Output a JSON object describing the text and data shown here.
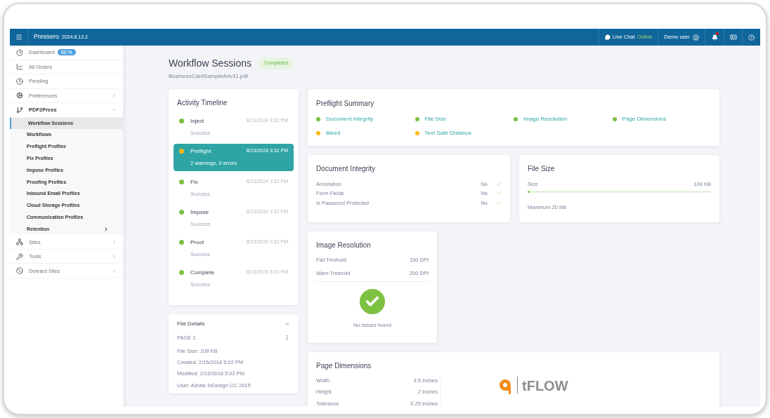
{
  "header": {
    "brand": "Pressero",
    "version": "2024.8.13.2",
    "live_chat": {
      "label": "Live Chat",
      "status": "Online"
    },
    "user": "Demo user",
    "notification_unread": true
  },
  "sidebar": {
    "items": [
      {
        "label": "Dashboard",
        "badge": "BETA",
        "kind": "link"
      },
      {
        "label": "All Orders",
        "kind": "link"
      },
      {
        "label": "Pending",
        "kind": "link"
      },
      {
        "label": "Preferences",
        "kind": "group",
        "expanded": false
      },
      {
        "label": "PDF2Press",
        "kind": "group",
        "expanded": true,
        "children": [
          {
            "label": "Workflow Sessions",
            "selected": true,
            "expandable": false
          },
          {
            "label": "Workflows",
            "selected": false,
            "expandable": false
          },
          {
            "label": "Preflight Profiles",
            "selected": false,
            "expandable": false
          },
          {
            "label": "Fix Profiles",
            "selected": false,
            "expandable": false
          },
          {
            "label": "Impose Profiles",
            "selected": false,
            "expandable": false
          },
          {
            "label": "Proofing Profiles",
            "selected": false,
            "expandable": false
          },
          {
            "label": "Inbound Email Profiles",
            "selected": false,
            "expandable": false
          },
          {
            "label": "Cloud Storage Profiles",
            "selected": false,
            "expandable": false
          },
          {
            "label": "Communication Profiles",
            "selected": false,
            "expandable": false
          },
          {
            "label": "Retention",
            "selected": false,
            "expandable": true
          }
        ]
      },
      {
        "label": "Sites",
        "kind": "group",
        "expanded": false
      },
      {
        "label": "Tools",
        "kind": "group",
        "expanded": false
      },
      {
        "label": "Deleted Sites",
        "kind": "group",
        "expanded": false
      }
    ]
  },
  "page": {
    "title": "Workflow Sessions",
    "status": "Completed",
    "file": "BusinessCardSampleArtv11.pdf"
  },
  "timeline": {
    "title": "Activity Timeline",
    "items": [
      {
        "name": "Inject",
        "time": "8/13/2024 3:32 PM",
        "result": "Success",
        "color": "#7cc142",
        "selected": false
      },
      {
        "name": "Preflight",
        "time": "8/13/2024 3:32 PM",
        "result": "2 warnings, 0 errors",
        "color": "#fdb913",
        "selected": true
      },
      {
        "name": "Fix",
        "time": "8/13/2024 3:32 PM",
        "result": "Success",
        "color": "#7cc142",
        "selected": false
      },
      {
        "name": "Impose",
        "time": "8/13/2024 3:32 PM",
        "result": "Success",
        "color": "#7cc142",
        "selected": false
      },
      {
        "name": "Proof",
        "time": "8/13/2024 3:32 PM",
        "result": "Success",
        "color": "#7cc142",
        "selected": false
      },
      {
        "name": "Complete",
        "time": "8/13/2024 3:33 PM",
        "result": "Success",
        "color": "#7cc142",
        "selected": false
      }
    ]
  },
  "file_details": {
    "title": "File Details",
    "expanded": true,
    "page": "PAGE 1",
    "lines": [
      "File Size: 108 KB",
      "Created: 2/15/2018 5:02 PM",
      "Modified: 2/15/2018 5:02 PM",
      "User: Adobe InDesign CC 2015"
    ]
  },
  "preflight_summary": {
    "title": "Preflight Summary",
    "items": [
      {
        "label": "Document Integrity",
        "color": "#7cc142"
      },
      {
        "label": "File Size",
        "color": "#7cc142"
      },
      {
        "label": "Image Resolution",
        "color": "#7cc142"
      },
      {
        "label": "Page Dimensions",
        "color": "#7cc142"
      },
      {
        "label": "Bleed",
        "color": "#fdb913"
      },
      {
        "label": "Text Safe Distance",
        "color": "#fdb913"
      }
    ]
  },
  "document_integrity": {
    "title": "Document Integrity",
    "rows": [
      {
        "label": "Annotation",
        "value": "No",
        "passed": true
      },
      {
        "label": "Form Fields",
        "value": "No",
        "passed": true
      },
      {
        "label": "Is Password Protected",
        "value": "No",
        "passed": true
      }
    ]
  },
  "file_size": {
    "title": "File Size",
    "label": "Size",
    "value": "108 KB",
    "level": 0.01,
    "maximum": "Maximum 20 Mb"
  },
  "image_resolution": {
    "title": "Image Resolution",
    "rows": [
      {
        "label": "Fail Treshold",
        "value": "150 DPI"
      },
      {
        "label": "Warn Treshold",
        "value": "200 DPI"
      }
    ],
    "passed": true,
    "message": "No issues found"
  },
  "page_dimensions": {
    "title": "Page Dimensions",
    "rows": [
      {
        "label": "Width",
        "value": "3.5 Inches"
      },
      {
        "label": "Height",
        "value": "2 Inches"
      },
      {
        "label": "Tolerance",
        "value": "0.25 Inches"
      }
    ],
    "logo_text": "tFLOW"
  }
}
